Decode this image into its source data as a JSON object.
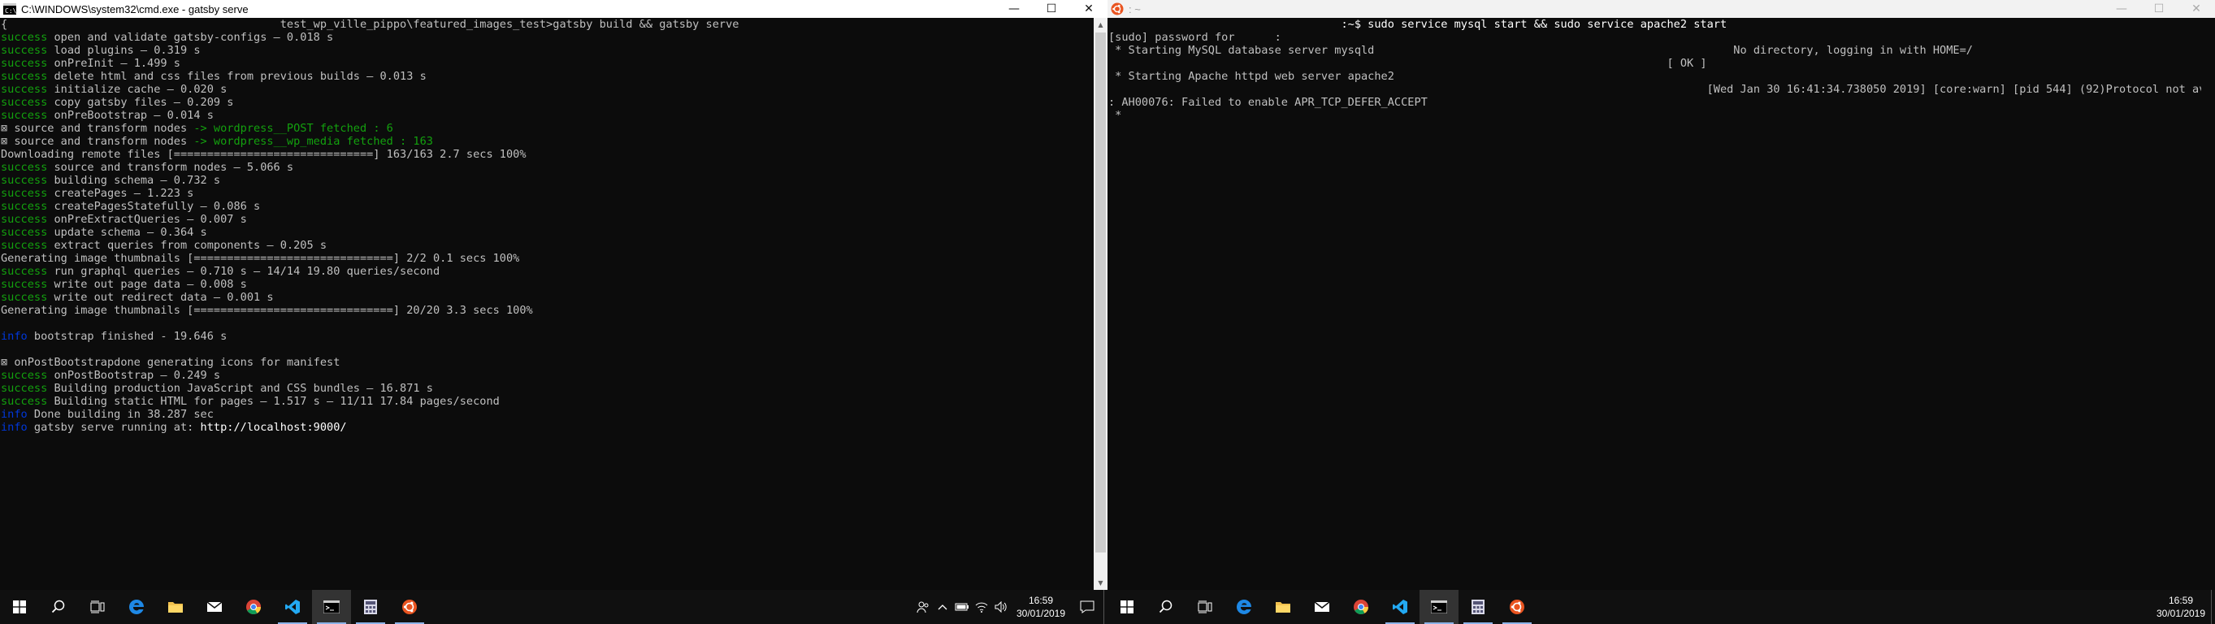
{
  "left_window": {
    "title": "C:\\WINDOWS\\system32\\cmd.exe - gatsby  serve",
    "controls": {
      "minimize": "—",
      "maximize": "☐",
      "close": "✕"
    },
    "lines": [
      [
        {
          "c": "gray",
          "t": "{                                         test_wp_ville_pippo\\featured_images_test>gatsby build && gatsby serve"
        }
      ],
      [
        {
          "c": "g",
          "t": "success"
        },
        {
          "c": "gray",
          "t": " open and validate gatsby-configs — 0.018 s"
        }
      ],
      [
        {
          "c": "g",
          "t": "success"
        },
        {
          "c": "gray",
          "t": " load plugins — 0.319 s"
        }
      ],
      [
        {
          "c": "g",
          "t": "success"
        },
        {
          "c": "gray",
          "t": " onPreInit — 1.499 s"
        }
      ],
      [
        {
          "c": "g",
          "t": "success"
        },
        {
          "c": "gray",
          "t": " delete html and css files from previous builds — 0.013 s"
        }
      ],
      [
        {
          "c": "g",
          "t": "success"
        },
        {
          "c": "gray",
          "t": " initialize cache — 0.020 s"
        }
      ],
      [
        {
          "c": "g",
          "t": "success"
        },
        {
          "c": "gray",
          "t": " copy gatsby files — 0.209 s"
        }
      ],
      [
        {
          "c": "g",
          "t": "success"
        },
        {
          "c": "gray",
          "t": " onPreBootstrap — 0.014 s"
        }
      ],
      [
        {
          "c": "gray",
          "t": "⊠ source and transform nodes "
        },
        {
          "c": "g",
          "t": "-> wordpress__POST fetched : 6"
        }
      ],
      [
        {
          "c": "gray",
          "t": "⊠ source and transform nodes "
        },
        {
          "c": "g",
          "t": "-> wordpress__wp_media fetched : 163"
        }
      ],
      [
        {
          "c": "gray",
          "t": "Downloading remote files [==============================] 163/163 2.7 secs 100%"
        }
      ],
      [
        {
          "c": "g",
          "t": "success"
        },
        {
          "c": "gray",
          "t": " source and transform nodes — 5.066 s"
        }
      ],
      [
        {
          "c": "g",
          "t": "success"
        },
        {
          "c": "gray",
          "t": " building schema — 0.732 s"
        }
      ],
      [
        {
          "c": "g",
          "t": "success"
        },
        {
          "c": "gray",
          "t": " createPages — 1.223 s"
        }
      ],
      [
        {
          "c": "g",
          "t": "success"
        },
        {
          "c": "gray",
          "t": " createPagesStatefully — 0.086 s"
        }
      ],
      [
        {
          "c": "g",
          "t": "success"
        },
        {
          "c": "gray",
          "t": " onPreExtractQueries — 0.007 s"
        }
      ],
      [
        {
          "c": "g",
          "t": "success"
        },
        {
          "c": "gray",
          "t": " update schema — 0.364 s"
        }
      ],
      [
        {
          "c": "g",
          "t": "success"
        },
        {
          "c": "gray",
          "t": " extract queries from components — 0.205 s"
        }
      ],
      [
        {
          "c": "gray",
          "t": "Generating image thumbnails [==============================] 2/2 0.1 secs 100%"
        }
      ],
      [
        {
          "c": "g",
          "t": "success"
        },
        {
          "c": "gray",
          "t": " run graphql queries — 0.710 s — 14/14 19.80 queries/second"
        }
      ],
      [
        {
          "c": "g",
          "t": "success"
        },
        {
          "c": "gray",
          "t": " write out page data — 0.008 s"
        }
      ],
      [
        {
          "c": "g",
          "t": "success"
        },
        {
          "c": "gray",
          "t": " write out redirect data — 0.001 s"
        }
      ],
      [
        {
          "c": "gray",
          "t": "Generating image thumbnails [==============================] 20/20 3.3 secs 100%"
        }
      ],
      [],
      [
        {
          "c": "b",
          "t": "info"
        },
        {
          "c": "gray",
          "t": " bootstrap finished - 19.646 s"
        }
      ],
      [],
      [
        {
          "c": "gray",
          "t": "⊠ onPostBootstrapdone generating icons for manifest"
        }
      ],
      [
        {
          "c": "g",
          "t": "success"
        },
        {
          "c": "gray",
          "t": " onPostBootstrap — 0.249 s"
        }
      ],
      [
        {
          "c": "g",
          "t": "success"
        },
        {
          "c": "gray",
          "t": " Building production JavaScript and CSS bundles — 16.871 s"
        }
      ],
      [
        {
          "c": "g",
          "t": "success"
        },
        {
          "c": "gray",
          "t": " Building static HTML for pages — 1.517 s — 11/11 17.84 pages/second"
        }
      ],
      [
        {
          "c": "b",
          "t": "info"
        },
        {
          "c": "gray",
          "t": " Done building in 38.287 sec"
        }
      ],
      [
        {
          "c": "b",
          "t": "info"
        },
        {
          "c": "gray",
          "t": " gatsby serve running at: "
        },
        {
          "c": "wb",
          "t": "http://localhost:9000/"
        }
      ]
    ]
  },
  "right_window": {
    "title": ": ~",
    "controls": {
      "minimize": "—",
      "maximize": "☐",
      "close": "✕"
    },
    "lines": [
      [
        {
          "c": "wb",
          "t": "                                   :~$ sudo service mysql start && sudo service apache2 start"
        }
      ],
      [
        {
          "c": "gray",
          "t": "[sudo] password for      :"
        }
      ],
      [
        {
          "c": "gray",
          "t": " * Starting MySQL database server mysqld                                                      No directory, logging in with HOME=/"
        }
      ],
      [
        {
          "c": "gray",
          "t": "                                                                                    [ OK ]"
        }
      ],
      [
        {
          "c": "gray",
          "t": " * Starting Apache httpd web server apache2"
        }
      ],
      [
        {
          "c": "gray",
          "t": "                                                                                          [Wed Jan 30 16:41:34.738050 2019] [core:warn] [pid 544] (92)Protocol not available"
        }
      ],
      [
        {
          "c": "gray",
          "t": ": AH00076: Failed to enable APR_TCP_DEFER_ACCEPT"
        }
      ],
      [
        {
          "c": "gray",
          "t": " *"
        }
      ]
    ]
  },
  "taskbar_left": {
    "apps": [
      {
        "name": "start-icon"
      },
      {
        "name": "search-icon"
      },
      {
        "name": "task-view-icon"
      },
      {
        "name": "edge-icon"
      },
      {
        "name": "file-explorer-icon"
      },
      {
        "name": "mail-icon"
      },
      {
        "name": "chrome-icon"
      },
      {
        "name": "vscode-icon"
      },
      {
        "name": "cmd-icon"
      },
      {
        "name": "calculator-icon"
      },
      {
        "name": "ubuntu-icon"
      }
    ],
    "time": "16:59",
    "date": "30/01/2019"
  },
  "taskbar_right": {
    "time": "16:59",
    "date": "30/01/2019"
  },
  "colors": {
    "success": "#13a10e",
    "info": "#0037da",
    "terminal_bg": "#0c0c0c",
    "ubuntu": "#e95420",
    "vscode": "#23a9f2",
    "edge": "#1e88e5"
  }
}
